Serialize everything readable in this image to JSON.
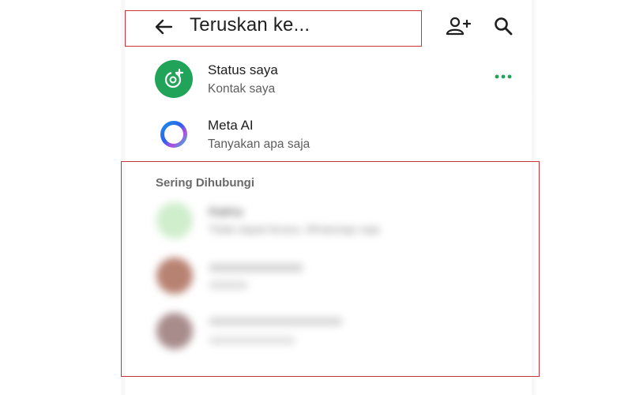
{
  "header": {
    "title": "Teruskan ke...",
    "icons": {
      "back": "arrow-left-icon",
      "add_contact": "person-add-icon",
      "search": "search-icon"
    }
  },
  "rows": [
    {
      "title": "Status saya",
      "subtitle": "Kontak saya",
      "icon": "status-camera-icon",
      "accent": "#21a35a"
    },
    {
      "title": "Meta AI",
      "subtitle": "Tanyakan apa saja",
      "icon": "meta-ai-ring-icon"
    }
  ],
  "frequent": {
    "label": "Sering Dihubungi",
    "contacts": [
      {
        "name": "Rakha",
        "status": "Tidak dapat bicara, WhatsApp saja"
      }
    ]
  },
  "colors": {
    "accent_green": "#21a35a",
    "highlight_red": "#c9343a",
    "more_dots": "#21a35a"
  }
}
